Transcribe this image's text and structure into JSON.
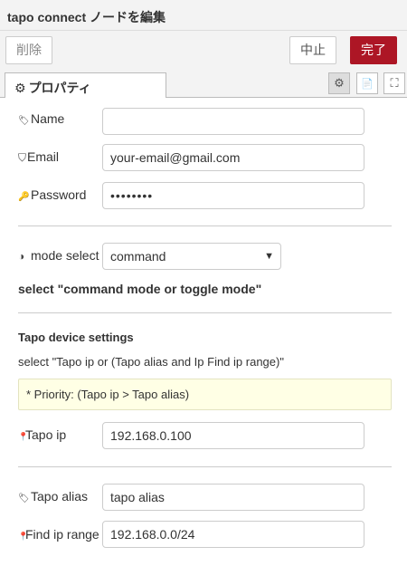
{
  "header": {
    "title": "tapo connect ノードを編集"
  },
  "toolbar": {
    "delete_label": "削除",
    "cancel_label": "中止",
    "done_label": "完了"
  },
  "tabs": {
    "properties_label": "プロパティ"
  },
  "icons": {
    "gear": "⚙",
    "tag": "🏷",
    "shield": "⛉",
    "key": "🔑",
    "half_circle": "◑",
    "pin": "📍",
    "doc": "📄",
    "frame": "⛶",
    "chevron": "⌄"
  },
  "fields": {
    "name": {
      "label": "Name",
      "value": ""
    },
    "email": {
      "label": "Email",
      "value": "your-email@gmail.com"
    },
    "password": {
      "label": "Password",
      "value": "••••••••"
    },
    "mode": {
      "label": "mode select",
      "value": "command"
    },
    "tapo_ip": {
      "label": "Tapo ip",
      "value": "192.168.0.100"
    },
    "tapo_alias": {
      "label": "Tapo alias",
      "value": "tapo alias"
    },
    "find_ip_range": {
      "label": "Find ip range",
      "value": "192.168.0.0/24"
    }
  },
  "texts": {
    "mode_hint": "select \"command mode or toggle mode\"",
    "device_settings_heading": "Tapo device settings",
    "device_hint": "select \"Tapo ip or (Tapo alias and Ip Find ip range)\"",
    "priority_note": "* Priority: (Tapo ip > Tapo alias)"
  },
  "colors": {
    "done_button": "#ad1625",
    "note_bg": "#ffffe5"
  }
}
